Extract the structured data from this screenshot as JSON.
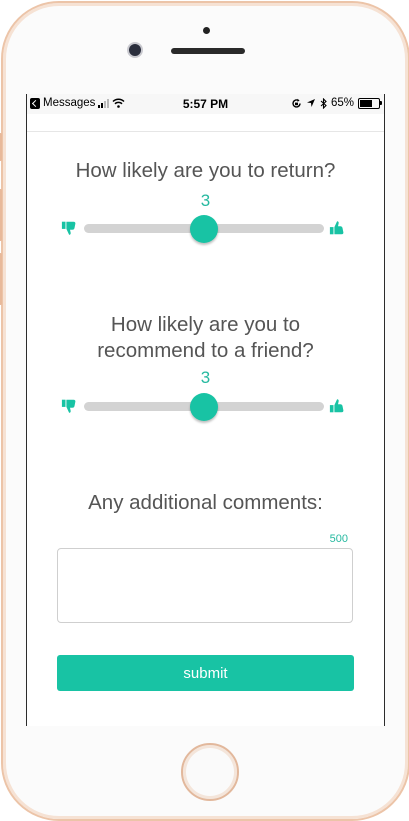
{
  "status_bar": {
    "back_app": "Messages",
    "time": "5:57 PM",
    "battery": "65%",
    "battery_level": 0.65
  },
  "survey": {
    "q1": {
      "question": "How likely are you to return?",
      "value": "3",
      "level": 0.5
    },
    "q2": {
      "question_line1": "How likely are you to",
      "question_line2": "recommend to a friend?",
      "value": "3",
      "level": 0.5
    },
    "comments": {
      "label": "Any additional comments:",
      "char_limit": "500",
      "value": "",
      "placeholder": ""
    },
    "submit_label": "submit"
  },
  "colors": {
    "accent": "#18c3a4",
    "accent_text": "#26b9a0",
    "track": "#d3d3d3",
    "question_text": "#555555"
  },
  "icons": [
    "back-arrow-icon",
    "cell-signal-icon",
    "wifi-icon",
    "lock-rotation-icon",
    "location-arrow-icon",
    "bluetooth-icon",
    "battery-icon",
    "thumbs-down-icon",
    "thumbs-up-icon"
  ]
}
